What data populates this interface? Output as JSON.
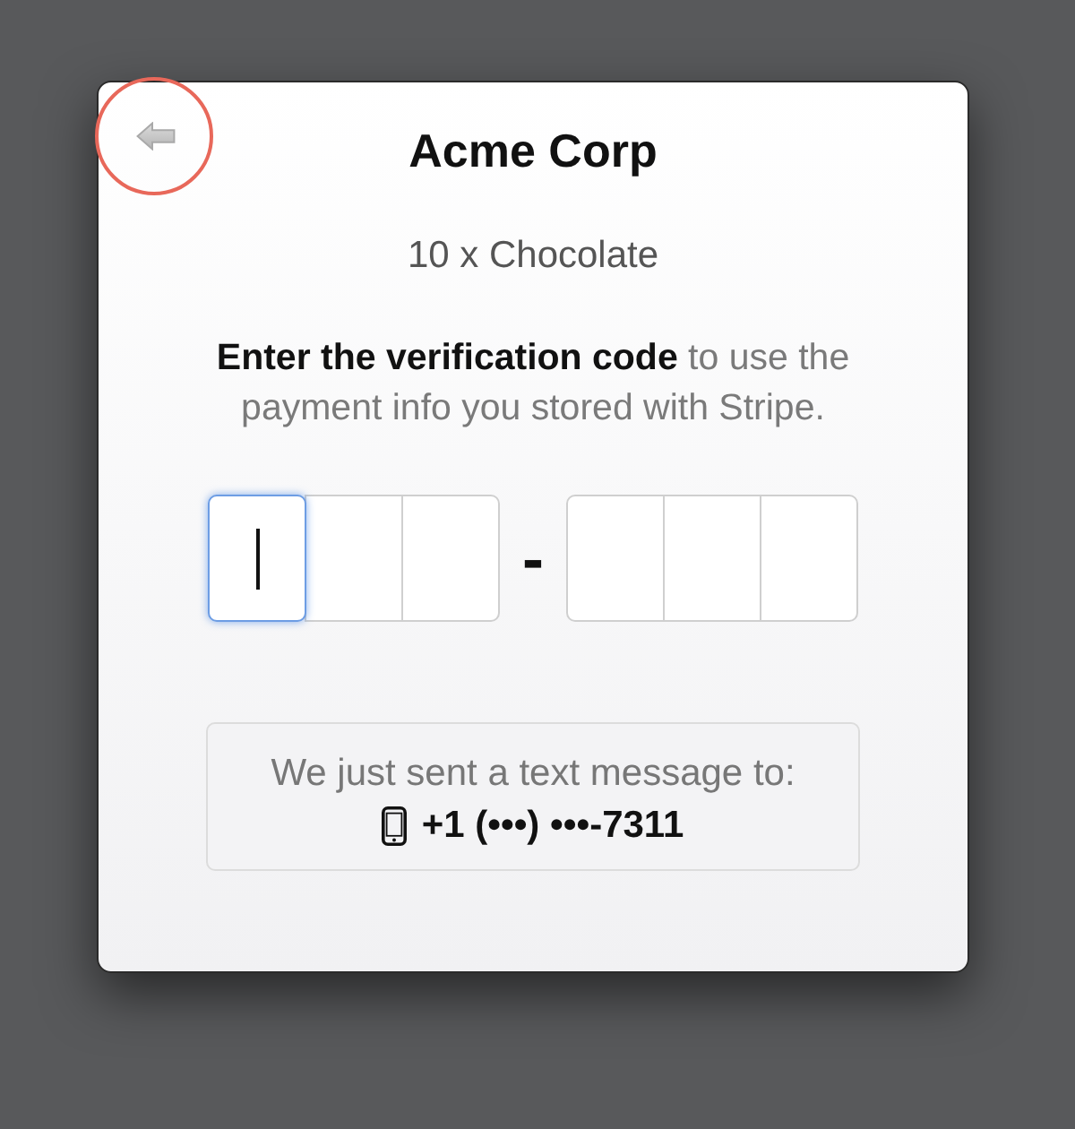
{
  "dialog": {
    "back_button": {
      "highlighted": true
    },
    "title": "Acme Corp",
    "subtitle": "10 x Chocolate",
    "instruction": "**Enter the verification code** to use the payment info you stored with Stripe.",
    "code_groups": [
      {
        "digits": [
          {
            "focused": true
          },
          {
            "focused": false
          },
          {
            "focused": false
          }
        ]
      },
      {
        "digits": [
          {
            "focused": false
          },
          {
            "focused": false
          },
          {
            "focused": false
          }
        ]
      }
    ],
    "separator": "-",
    "notice": {
      "text": "We just sent a text message to:",
      "phone": "+1 (•••) •••-7311"
    }
  }
}
